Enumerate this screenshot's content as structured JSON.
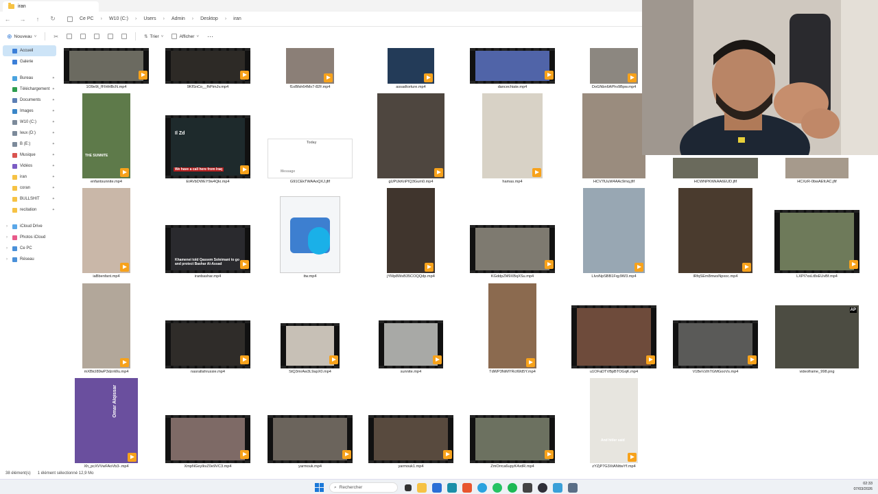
{
  "window": {
    "tab_title": "iran"
  },
  "nav": {
    "back": "←",
    "forward": "→",
    "up": "↑",
    "refresh": "↻"
  },
  "breadcrumb": [
    "Ce PC",
    "W10 (C:)",
    "Users",
    "Admin",
    "Desktop",
    "iran"
  ],
  "toolbar": {
    "new_label": "Nouveau",
    "sort_label": "Trier",
    "view_label": "Afficher",
    "more": "···"
  },
  "sidebar": {
    "top": [
      {
        "label": "Accueil",
        "color": "#3b7fd8"
      },
      {
        "label": "Galerie",
        "color": "#3b7fd8"
      }
    ],
    "pinned": [
      {
        "label": "Bureau",
        "color": "#4aa3df"
      },
      {
        "label": "Téléchargement",
        "color": "#2e9d4f"
      },
      {
        "label": "Documents",
        "color": "#5c7fb5"
      },
      {
        "label": "Images",
        "color": "#3a86c8"
      },
      {
        "label": "W10 (C:)",
        "color": "#7c8a9a"
      },
      {
        "label": "Ieux (D:)",
        "color": "#7c8a9a"
      },
      {
        "label": "B (E:)",
        "color": "#7c8a9a"
      },
      {
        "label": "Musique",
        "color": "#d9534f"
      },
      {
        "label": "Vidéos",
        "color": "#7b5cc4"
      },
      {
        "label": "iran",
        "color": "#f6c244"
      },
      {
        "label": "coran",
        "color": "#f6c244"
      },
      {
        "label": "BULLSHIT",
        "color": "#f6c244"
      },
      {
        "label": "recitation",
        "color": "#f6c244"
      }
    ],
    "places": [
      {
        "label": "iCloud Drive",
        "color": "#5aa7e8"
      },
      {
        "label": "Photos iCloud",
        "color": "#e85a8a"
      },
      {
        "label": "Ce PC",
        "color": "#4a90d9"
      },
      {
        "label": "Réseau",
        "color": "#4a90d9"
      }
    ]
  },
  "files": [
    {
      "name": "1O9e9t_fFIHHBcN.mp4"
    },
    {
      "name": "9KfSnCo__fhPimJv.mp4"
    },
    {
      "name": "f1oBfsh64Mx7-82F.mp4"
    },
    {
      "name": "assadtorture.mp4"
    },
    {
      "name": "dancechiate.mp4"
    },
    {
      "name": "DoGNbn6APhv9Bpw.mp4"
    },
    {
      "name": "enfantsunnite.mp4"
    },
    {
      "name": "EIAVbDWEY9w4Qki.mp4"
    },
    {
      "name": "G91CEkTWAAoQXJ.jfif"
    },
    {
      "name": "gUPUkKnPIQ3Gum0.mp4"
    },
    {
      "name": "hamas.mp4"
    },
    {
      "name": "HCV7lUuW4AAc9mq.jfif"
    },
    {
      "name": "HCWNPKWkAA6EUD.jfif"
    },
    {
      "name": "HCXzR-0bwAEfcAC.jfif"
    },
    {
      "name": "iaBbenfant.mp4"
    },
    {
      "name": "iranbashar.mp4"
    },
    {
      "name": "itw.mp4"
    },
    {
      "name": "jYMp8WsB35COQQdp.mp4"
    },
    {
      "name": "KGddpZM9XBqXSu.mp4"
    },
    {
      "name": "LIvoNpSBB1Fqy9W3.mp4"
    },
    {
      "name": "lRfqSEm8mwsNpxoc.mp4"
    },
    {
      "name": "LXPI7xsLt8xEUvBf.mp4"
    },
    {
      "name": "mXBtcI89wP3dznWu.mp4"
    },
    {
      "name": "nasrallahrussie.mp4"
    },
    {
      "name": "StQ3mrAw3L9apX0.mp4"
    },
    {
      "name": "sunnite.mp4"
    },
    {
      "name": "TdWP3NiMYRctWd5Y.mp4"
    },
    {
      "name": "u1OFaDTVBpBTOGqK.mp4"
    },
    {
      "name": "V1BeVzIhTGMGooVs.mp4"
    },
    {
      "name": "videoframe_998.png"
    },
    {
      "name": "Xh_pcXVVwFAoVb3-.mp4"
    },
    {
      "name": "XmpNGeyIkvZ0e9VC3.mp4"
    },
    {
      "name": "yarmouk.mp4"
    },
    {
      "name": "yarmouk1.mp4"
    },
    {
      "name": "ZmOrrca6upyK4vdR.mp4"
    },
    {
      "name": "zYZjP7G3XtANttwYf.mp4"
    }
  ],
  "thumb_text": {
    "sunnite": "THE SUNNITE",
    "zd": "Il Zd",
    "banner": "We have a call here from Iraq",
    "iranbashar": "Khamenei told Qassem Soleimani to go and protect Bashar Al-Assad",
    "today": "Today",
    "message": "Message",
    "omar": "Omar Alqissar",
    "hitler": "And hitler said",
    "ap": "AP"
  },
  "status": {
    "count": "38 élément(s)",
    "selection": "1 élément sélectionné  12,9 Mo"
  },
  "taskbar": {
    "search_placeholder": "Rechercher",
    "time": "02:33",
    "date": "07/03/2026"
  }
}
